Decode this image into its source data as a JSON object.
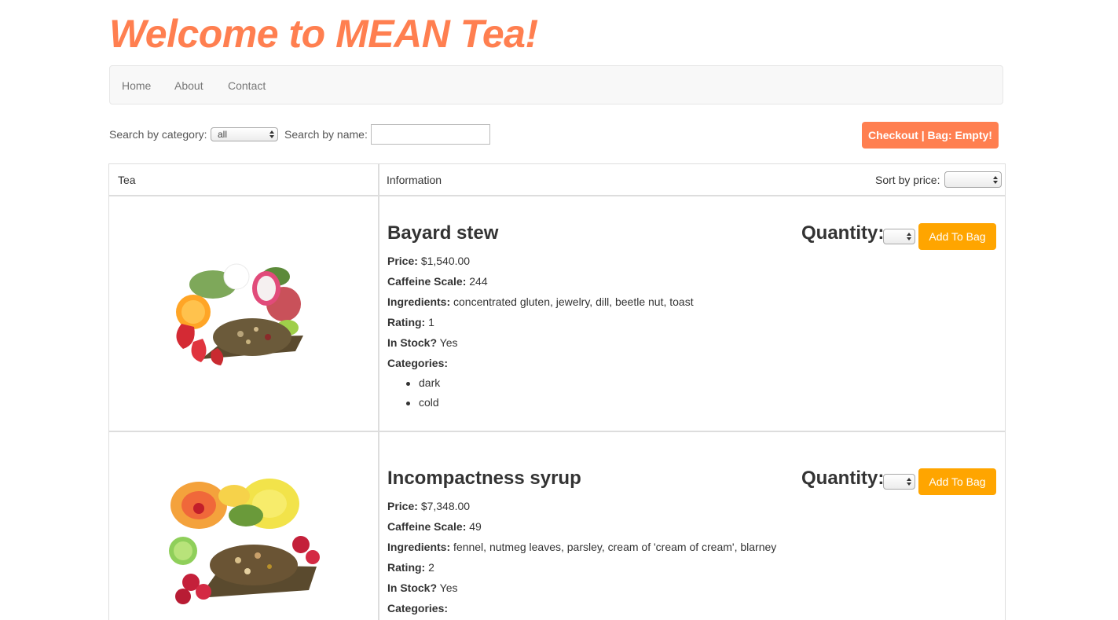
{
  "header": {
    "title": "Welcome to MEAN Tea!"
  },
  "nav": {
    "items": [
      "Home",
      "About",
      "Contact"
    ]
  },
  "search": {
    "category_label": "Search by category:",
    "category_value": "all",
    "name_label": "Search by name:",
    "name_value": ""
  },
  "checkout": {
    "label": "Checkout | Bag: Empty!"
  },
  "table": {
    "col_tea": "Tea",
    "col_info": "Information",
    "sort_label": "Sort by price:",
    "sort_value": ""
  },
  "labels": {
    "price": "Price:",
    "caffeine": "Caffeine Scale:",
    "ingredients": "Ingredients:",
    "rating": "Rating:",
    "in_stock": "In Stock?",
    "categories": "Categories:",
    "quantity": "Quantity:",
    "add_to_bag": "Add To Bag"
  },
  "teas": [
    {
      "name": "Bayard stew",
      "price": "$1,540.00",
      "caffeine": "244",
      "ingredients": "concentrated gluten, jewelry, dill, beetle nut, toast",
      "rating": "1",
      "in_stock": "Yes",
      "categories": [
        "dark",
        "cold"
      ],
      "quantity": ""
    },
    {
      "name": "Incompactness syrup",
      "price": "$7,348.00",
      "caffeine": "49",
      "ingredients": "fennel, nutmeg leaves, parsley, cream of 'cream of cream', blarney",
      "rating": "2",
      "in_stock": "Yes",
      "categories": [],
      "quantity": ""
    }
  ],
  "colors": {
    "title": "#ff7f50",
    "checkout_button": "#ff7f50",
    "add_button": "#ffa500"
  }
}
